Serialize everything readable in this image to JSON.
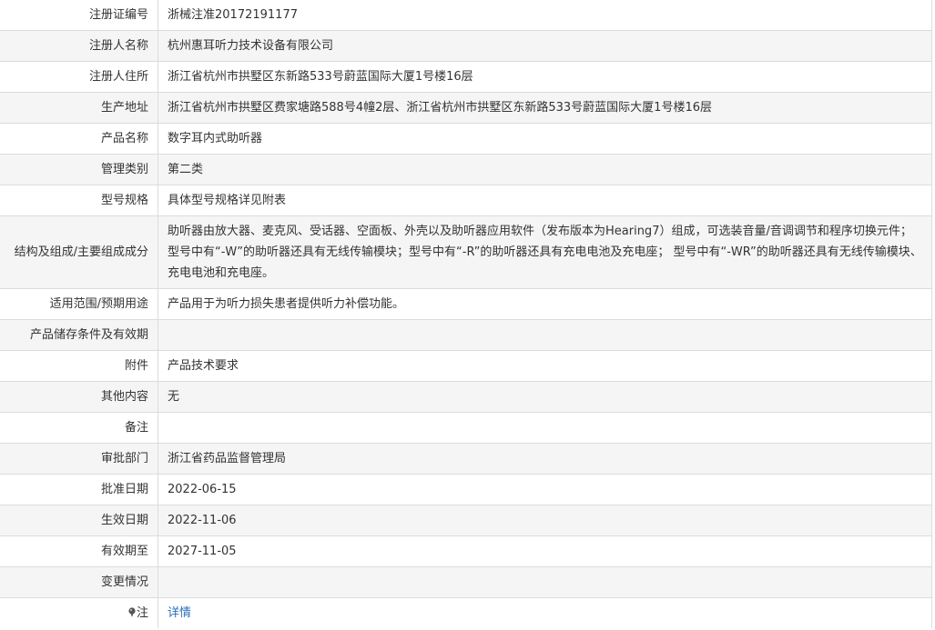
{
  "rows": [
    {
      "label": "注册证编号",
      "value": "浙械注准20172191177"
    },
    {
      "label": "注册人名称",
      "value": "杭州惠耳听力技术设备有限公司"
    },
    {
      "label": "注册人住所",
      "value": "浙江省杭州市拱墅区东新路533号蔚蓝国际大厦1号楼16层"
    },
    {
      "label": "生产地址",
      "value": "浙江省杭州市拱墅区费家塘路588号4幢2层、浙江省杭州市拱墅区东新路533号蔚蓝国际大厦1号楼16层"
    },
    {
      "label": "产品名称",
      "value": "数字耳内式助听器"
    },
    {
      "label": "管理类别",
      "value": "第二类"
    },
    {
      "label": "型号规格",
      "value": "具体型号规格详见附表"
    },
    {
      "label": "结构及组成/主要组成成分",
      "value": "助听器由放大器、麦克风、受话器、空面板、外壳以及助听器应用软件（发布版本为Hearing7）组成，可选装音量/音调调节和程序切换元件；型号中有“-W”的助听器还具有无线传输模块；型号中有“-R”的助听器还具有充电电池及充电座； 型号中有“-WR”的助听器还具有无线传输模块、充电电池和充电座。"
    },
    {
      "label": "适用范围/预期用途",
      "value": "产品用于为听力损失患者提供听力补偿功能。"
    },
    {
      "label": "产品储存条件及有效期",
      "value": ""
    },
    {
      "label": "附件",
      "value": "产品技术要求"
    },
    {
      "label": "其他内容",
      "value": "无"
    },
    {
      "label": "备注",
      "value": ""
    },
    {
      "label": "审批部门",
      "value": "浙江省药品监督管理局"
    },
    {
      "label": "批准日期",
      "value": "2022-06-15"
    },
    {
      "label": "生效日期",
      "value": "2022-11-06"
    },
    {
      "label": "有效期至",
      "value": "2027-11-05"
    },
    {
      "label": "变更情况",
      "value": ""
    }
  ],
  "note_row": {
    "label": "注",
    "icon": "pin-icon",
    "link_text": "详情"
  },
  "colors": {
    "border": "#dcdcdc",
    "stripe": "#f5f5f5",
    "link": "#2a6db5"
  }
}
